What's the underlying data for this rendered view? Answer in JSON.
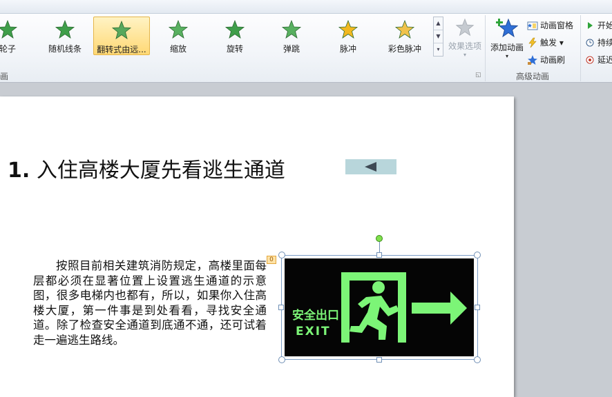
{
  "gallery": {
    "items": [
      {
        "label": "轮子",
        "color": "#3f9e4a"
      },
      {
        "label": "随机线条",
        "color": "#3f9e4a"
      },
      {
        "label": "翻转式由远...",
        "color": "#58a85c",
        "selected": true
      },
      {
        "label": "缩放",
        "color": "#58b060"
      },
      {
        "label": "旋转",
        "color": "#3f9e4a"
      },
      {
        "label": "弹跳",
        "color": "#58b060"
      },
      {
        "label": "脉冲",
        "color": "#f2b820"
      },
      {
        "label": "彩色脉冲",
        "color": "#f0c24a"
      }
    ],
    "scroll_up": "▲",
    "scroll_down": "▼",
    "scroll_more": "▾",
    "group_label": "画"
  },
  "effect_options": {
    "label": "效果选项",
    "arrow": "▾"
  },
  "advanced": {
    "add_animation": {
      "label": "添加动画",
      "arrow": "▾"
    },
    "animation_pane": "动画窗格",
    "trigger": "触发 ▾",
    "animation_painter": "动画刷",
    "group_label": "高级动画"
  },
  "timing": {
    "start": "开始",
    "duration": "持续",
    "delay": "延迟"
  },
  "slide": {
    "title_number": "1.",
    "title_text": "入住高楼大厦先看逃生通道",
    "body": "按照目前相关建筑消防规定，高楼里面每层都必须在显著位置上设置逃生通道的示意图，很多电梯内也都有，所以，如果你入住高楼大厦，第一件事是到处看看，寻找安全通道。除了检查安全通道到底通不通，还可试着走一遍逃生路线。",
    "anim_tag": "0",
    "exit_sign": {
      "zh": "安全出口",
      "en": "EXIT",
      "glow_color": "#7cf577"
    }
  }
}
